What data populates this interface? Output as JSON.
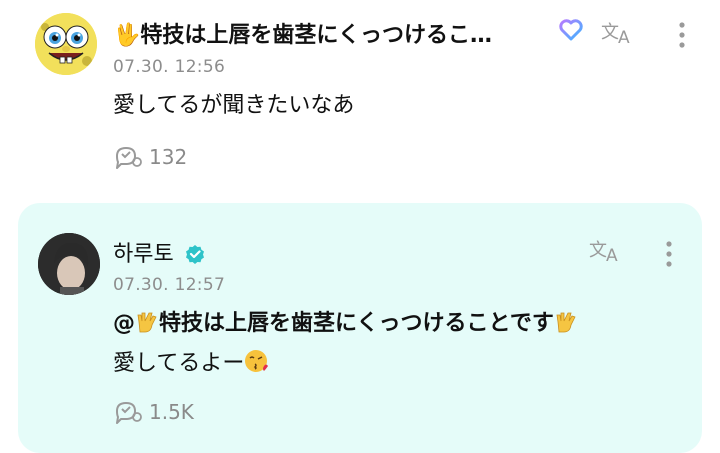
{
  "posts": [
    {
      "username": "🖖特技は上唇を歯茎にくっつけるこ…",
      "timestamp": "07.30. 12:56",
      "body": "愛してるが聞きたいなあ",
      "reaction_count": "132"
    },
    {
      "username": "하루토",
      "timestamp": "07.30. 12:57",
      "mention": "@",
      "mention_text": "特技は上唇を歯茎にくっつけることです",
      "body_line2": "愛してるよー",
      "reaction_count": "1.5K"
    }
  ],
  "colors": {
    "highlight_bg": "#e5fcf9",
    "verified": "#2ec3c9",
    "timestamp": "#8d8d8d",
    "icon": "#9a9a9a"
  },
  "icons": {
    "translate": "translate-icon",
    "more": "more-vertical-icon",
    "reaction": "reaction-icon",
    "heart_badge": "heart-badge-icon",
    "verified": "verified-badge-icon"
  }
}
